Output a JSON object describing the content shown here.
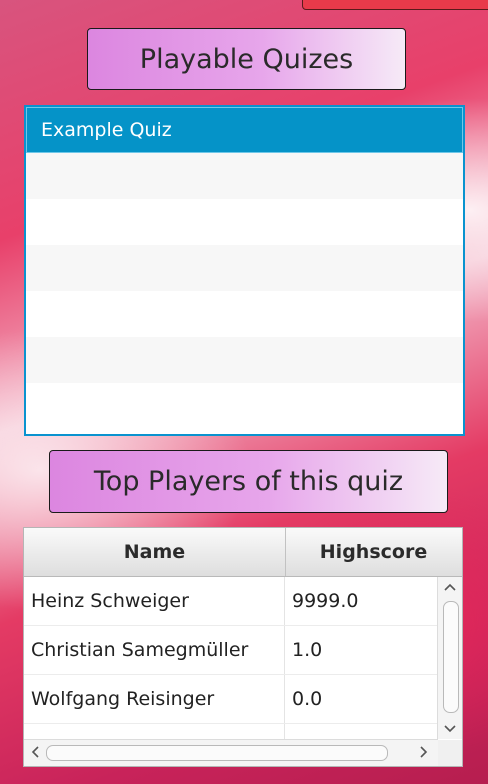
{
  "quizzes": {
    "title": "Playable Quizes",
    "items": [
      "Example Quiz"
    ]
  },
  "top_players": {
    "title": "Top Players of this quiz",
    "columns": {
      "name": "Name",
      "score": "Highscore"
    },
    "rows": [
      {
        "name": "Heinz Schweiger",
        "score": "9999.0"
      },
      {
        "name": "Christian Samegmüller",
        "score": "1.0"
      },
      {
        "name": "Wolfgang Reisinger",
        "score": "0.0"
      }
    ]
  },
  "icons": {
    "scroll_up": "chevron-up-icon",
    "scroll_down": "chevron-down-icon",
    "scroll_left": "chevron-left-icon",
    "scroll_right": "chevron-right-icon"
  },
  "colors": {
    "accent": "#0593c8",
    "title_gradient_start": "#dc86e0",
    "title_gradient_end": "#f6eaf7"
  }
}
